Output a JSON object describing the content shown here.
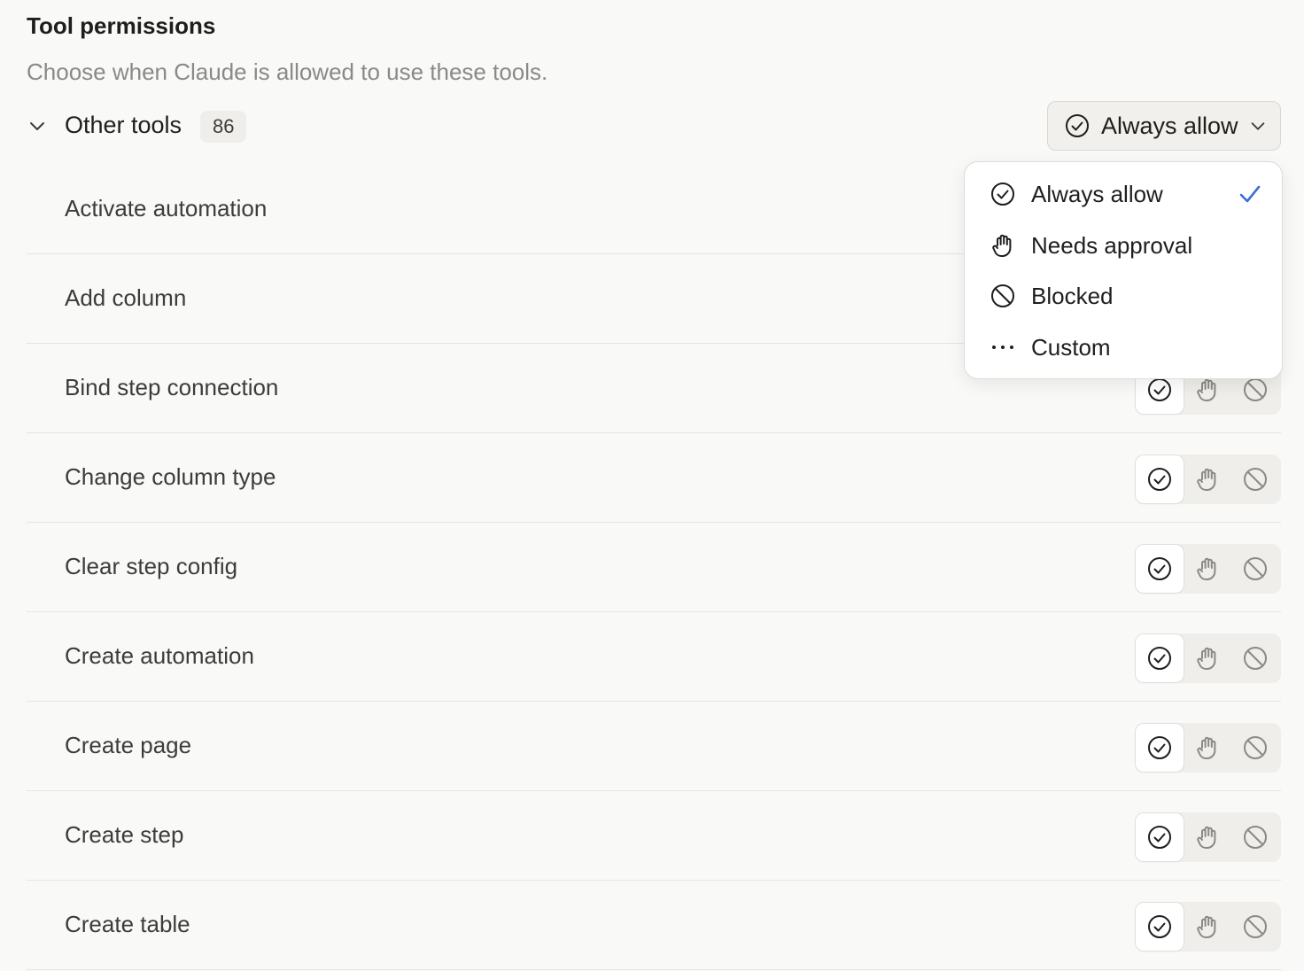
{
  "header": {
    "title": "Tool permissions",
    "subtitle": "Choose when Claude is allowed to use these tools."
  },
  "group": {
    "name": "Other tools",
    "count": "86",
    "selected": "Always allow",
    "expanded": true
  },
  "dropdown": {
    "options": [
      {
        "label": "Always allow",
        "icon": "check-circle-icon",
        "selected": true
      },
      {
        "label": "Needs approval",
        "icon": "hand-icon",
        "selected": false
      },
      {
        "label": "Blocked",
        "icon": "blocked-icon",
        "selected": false
      },
      {
        "label": "Custom",
        "icon": "more-dots-icon",
        "selected": false
      }
    ]
  },
  "tools": [
    {
      "name": "Activate automation",
      "permission": "Always allow"
    },
    {
      "name": "Add column",
      "permission": "Always allow"
    },
    {
      "name": "Bind step connection",
      "permission": "Always allow"
    },
    {
      "name": "Change column type",
      "permission": "Always allow"
    },
    {
      "name": "Clear step config",
      "permission": "Always allow"
    },
    {
      "name": "Create automation",
      "permission": "Always allow"
    },
    {
      "name": "Create page",
      "permission": "Always allow"
    },
    {
      "name": "Create step",
      "permission": "Always allow"
    },
    {
      "name": "Create table",
      "permission": "Always allow"
    }
  ],
  "colors": {
    "accent_check": "#3b6fd8",
    "muted_icon": "#8a8986",
    "active_icon": "#1f1e1d"
  }
}
